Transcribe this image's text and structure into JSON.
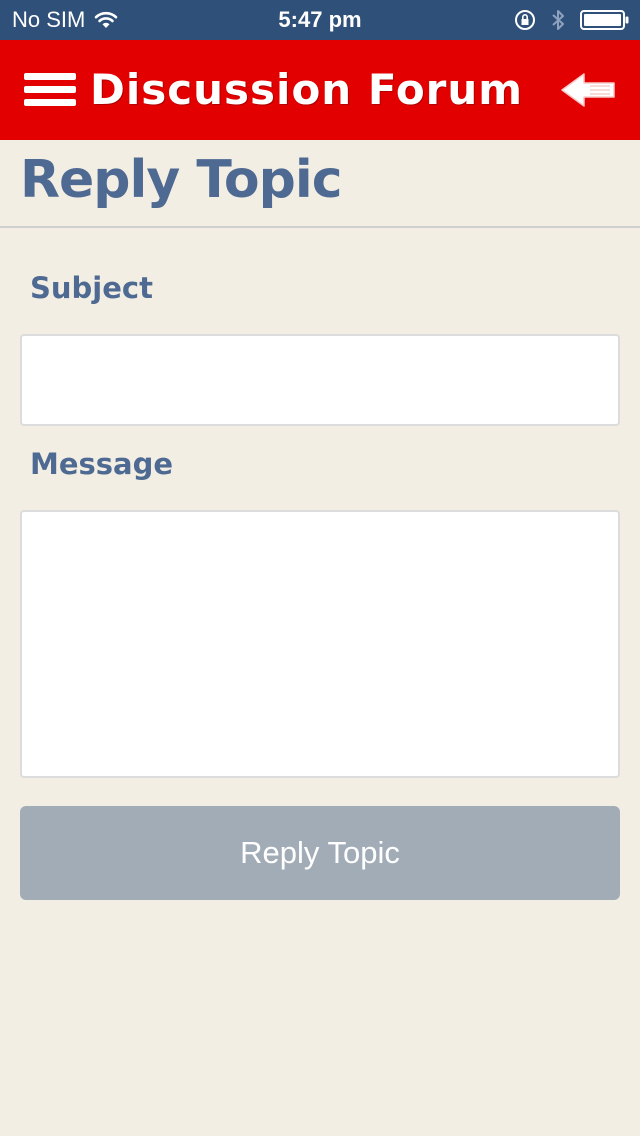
{
  "status_bar": {
    "carrier": "No SIM",
    "time": "5:47 pm",
    "icons": [
      "wifi-icon",
      "orientation-lock-icon",
      "bluetooth-icon",
      "battery-icon"
    ]
  },
  "header": {
    "title": "Discussion Forum",
    "menu_icon": "menu-icon",
    "back_icon": "back-arrow-icon",
    "background": "#e20000"
  },
  "page": {
    "title": "Reply Topic"
  },
  "form": {
    "subject_label": "Subject",
    "subject_value": "",
    "message_label": "Message",
    "message_value": "",
    "submit_label": "Reply Topic"
  },
  "colors": {
    "status_bar": "#2f5079",
    "header": "#e20000",
    "accent_text": "#4f6a92",
    "background": "#f3eee4",
    "button": "#a2acb7"
  }
}
